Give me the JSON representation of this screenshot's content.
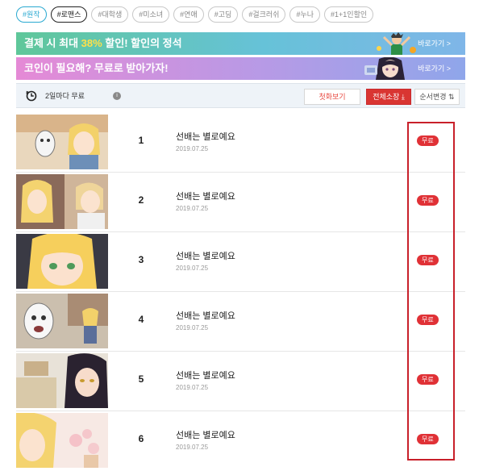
{
  "tags": [
    "#원작",
    "#로맨스",
    "#대학생",
    "#미소녀",
    "#연애",
    "#고딩",
    "#걸크러쉬",
    "#누나",
    "#1+1인할인"
  ],
  "banners": [
    {
      "text_pre": "결제 시 최대 ",
      "text_highlight": "38%",
      "text_post": " 할인! 할인의 정석",
      "link": "바로가기 >"
    },
    {
      "text": "코인이 필요해? 무료로 받아가자!",
      "link": "바로가기 >"
    }
  ],
  "toolbar": {
    "label": "2일마다 무료",
    "first_button": "첫화보기",
    "all_button": "전체소장",
    "sort_button": "순서변경"
  },
  "episodes": [
    {
      "num": "1",
      "title": "선배는 별로예요",
      "date": "2019.07.25",
      "badge": "무료"
    },
    {
      "num": "2",
      "title": "선배는 별로예요",
      "date": "2019.07.25",
      "badge": "무료"
    },
    {
      "num": "3",
      "title": "선배는 별로예요",
      "date": "2019.07.25",
      "badge": "무료"
    },
    {
      "num": "4",
      "title": "선배는 별로예요",
      "date": "2019.07.25",
      "badge": "무료"
    },
    {
      "num": "5",
      "title": "선배는 별로예요",
      "date": "2019.07.25",
      "badge": "무료"
    },
    {
      "num": "6",
      "title": "선배는 별로예요",
      "date": "2019.07.25",
      "badge": "무료"
    }
  ],
  "colors": {
    "accent_red": "#e03136",
    "highlight_box": "#c8202a",
    "tag_active": "#2aa9d1"
  }
}
